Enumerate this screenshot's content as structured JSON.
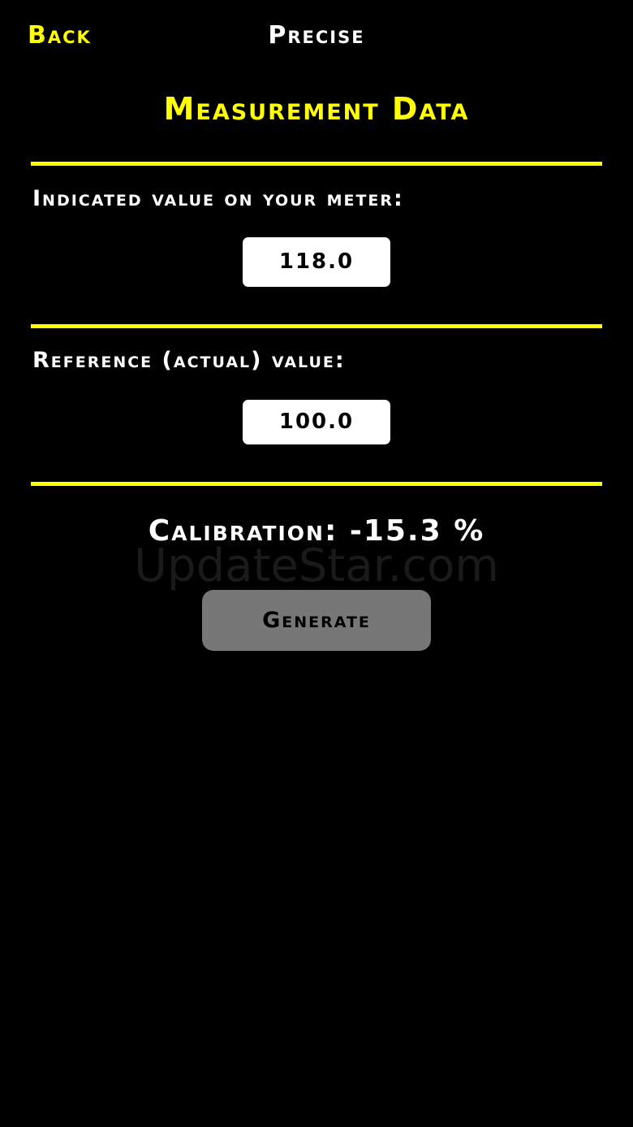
{
  "nav": {
    "back_label": "Back",
    "title": "Precise"
  },
  "section": {
    "title": "Measurement Data"
  },
  "fields": {
    "indicated": {
      "label": "Indicated value on your meter:",
      "value": "118.0"
    },
    "reference": {
      "label": "Reference (actual) value:",
      "value": "100.0"
    }
  },
  "result": {
    "calibration_text": "Calibration: -15.3 %"
  },
  "watermark": {
    "text": "UpdateStar.com"
  },
  "actions": {
    "generate_label": "Generate"
  },
  "colors": {
    "accent": "#ffff00",
    "background": "#000000",
    "button": "#777777",
    "field_background": "#ffffff"
  }
}
